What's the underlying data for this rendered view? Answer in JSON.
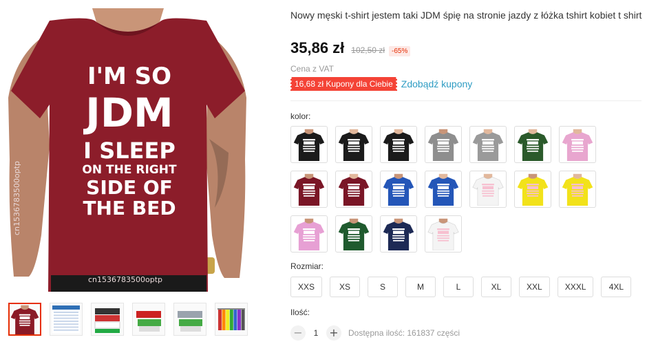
{
  "product": {
    "title": "Nowy męski t-shirt jestem taki JDM śpię na stronie jazdy z łóżka tshirt kobiet t shirt",
    "price": "35,86 zł",
    "old_price": "102,50 zł",
    "discount": "-65%",
    "vat_note": "Cena z VAT",
    "coupon_label": "16,68 zł Kupony dla Ciebie",
    "coupon_link": "Zdobądź kupony"
  },
  "gallery": {
    "shirt_lines": [
      "I'M SO",
      "JDM",
      "I SLEEP",
      "ON THE RIGHT",
      "SIDE OF",
      "THE BED"
    ],
    "watermark": "cn1536783500optp",
    "thumbnails": [
      {
        "name": "thumb-1",
        "kind": "shirt",
        "color": "#8b1a26"
      },
      {
        "name": "thumb-2",
        "kind": "size-chart",
        "color": "#2f6fb5"
      },
      {
        "name": "thumb-3",
        "kind": "stack",
        "color": "#666666"
      },
      {
        "name": "thumb-4",
        "kind": "fold",
        "color": "#c22"
      },
      {
        "name": "thumb-5",
        "kind": "fold",
        "color": "#9aa3ad"
      },
      {
        "name": "thumb-6",
        "kind": "rack",
        "color": "#7a7a7a"
      }
    ]
  },
  "options": {
    "color_label": "kolor:",
    "colors": [
      {
        "hex": "#1b1b1b",
        "model": "man"
      },
      {
        "hex": "#1b1b1b",
        "model": "woman"
      },
      {
        "hex": "#1b1b1b",
        "model": "woman"
      },
      {
        "hex": "#8e8e8e",
        "model": "man"
      },
      {
        "hex": "#9a9a9a",
        "model": "woman"
      },
      {
        "hex": "#2b5a2b",
        "model": "woman"
      },
      {
        "hex": "#e8a6cf",
        "model": "woman"
      },
      {
        "hex": "#7a1626",
        "model": "man"
      },
      {
        "hex": "#7a1626",
        "model": "woman"
      },
      {
        "hex": "#2456b8",
        "model": "man"
      },
      {
        "hex": "#2456b8",
        "model": "woman"
      },
      {
        "hex": "#f4f4f4",
        "model": "woman"
      },
      {
        "hex": "#f2e21a",
        "model": "man"
      },
      {
        "hex": "#f2e21a",
        "model": "woman"
      },
      {
        "hex": "#e7a0d4",
        "model": "man"
      },
      {
        "hex": "#1f5a2e",
        "model": "man"
      },
      {
        "hex": "#1d2a55",
        "model": "man"
      },
      {
        "hex": "#f4f4f4",
        "model": "man"
      }
    ],
    "size_label": "Rozmiar:",
    "sizes": [
      "XXS",
      "XS",
      "S",
      "M",
      "L",
      "XL",
      "XXL",
      "XXXL",
      "4XL"
    ]
  },
  "quantity": {
    "label": "Ilość:",
    "value": "1",
    "minus": "−",
    "plus": "+",
    "stock": "Dostępna ilość: 161837 części"
  }
}
